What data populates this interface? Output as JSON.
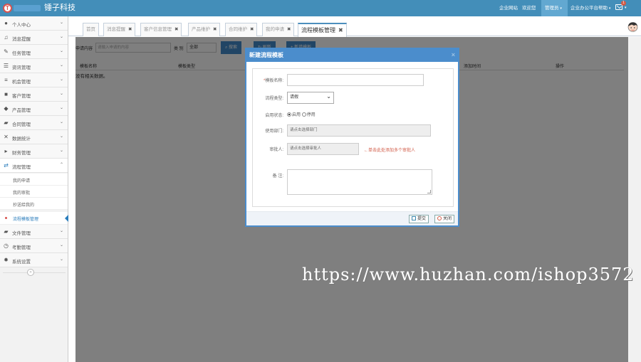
{
  "header": {
    "brand": "锤子科技",
    "links": [
      "企业网站",
      "欢迎您",
      "管理员",
      "企业办公平台帮助"
    ],
    "mail_count": "1",
    "colors": {
      "bar": "#438eb9",
      "active": "#62a8d1"
    }
  },
  "sidebar": {
    "items": [
      {
        "label": "个人中心",
        "icon": "user-icon"
      },
      {
        "label": "消息提醒",
        "icon": "bell-icon"
      },
      {
        "label": "任务管理",
        "icon": "edit-icon"
      },
      {
        "label": "资讯管理",
        "icon": "list-icon"
      },
      {
        "label": "机会管理",
        "icon": "menu-icon"
      },
      {
        "label": "客户管理",
        "icon": "users-icon"
      },
      {
        "label": "产品管理",
        "icon": "dropbox-icon"
      },
      {
        "label": "合同管理",
        "icon": "folder-icon"
      },
      {
        "label": "数据统计",
        "icon": "shuffle-icon"
      },
      {
        "label": "财务管理",
        "icon": "money-icon"
      },
      {
        "label": "流程管理",
        "icon": "process-icon"
      }
    ],
    "subitems": [
      "我的申请",
      "我的审批",
      "抄送给我的",
      "流程模板管理"
    ],
    "items_after": [
      {
        "label": "文件管理",
        "icon": "folder-open-icon"
      },
      {
        "label": "考勤管理",
        "icon": "clock-icon"
      },
      {
        "label": "系统设置",
        "icon": "gear-icon"
      }
    ],
    "collapse_glyph": "«"
  },
  "tabs": [
    {
      "label": "首页"
    },
    {
      "label": "消息提醒"
    },
    {
      "label": "客户信息管理"
    },
    {
      "label": "产品维护"
    },
    {
      "label": "合同维护"
    },
    {
      "label": "我的申请"
    },
    {
      "label": "流程模板管理"
    }
  ],
  "search": {
    "label": "申请内容",
    "placeholder": "请输入申请的内容",
    "type_label": "类 别",
    "type_value": "全部",
    "search_button": "搜索",
    "refresh_button": "刷新",
    "new_button": "新增模板"
  },
  "table": {
    "columns": [
      "模板名称",
      "模板类型",
      "添加时间",
      "操作"
    ],
    "empty_text": "没有相关数据。"
  },
  "modal": {
    "title": "新建流程模板",
    "close": "×",
    "fields": {
      "name_label": "模板名称:",
      "name_required": "*",
      "type_label": "流程类型:",
      "type_value": "请假",
      "status_label": "启用状态:",
      "status_on": "启用",
      "status_off": "停用",
      "dept_label": "使用部门:",
      "dept_placeholder": "请点击选择部门",
      "approver_label": "审批人:",
      "approver_placeholder": "请点击选择审批人",
      "approver_hint": "←单击此处添加多个审批人",
      "remark_label": "备 注:"
    },
    "submit": "提交",
    "cancel": "关闭"
  },
  "watermark": "https://www.huzhan.com/ishop3572"
}
